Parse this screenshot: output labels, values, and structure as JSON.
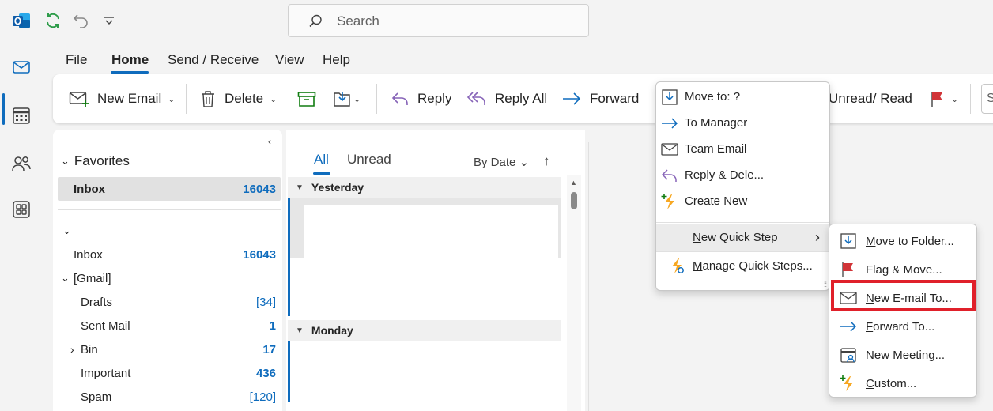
{
  "search": {
    "placeholder": "Search"
  },
  "menu": {
    "items": [
      "File",
      "Home",
      "Send / Receive",
      "View",
      "Help"
    ],
    "active": "Home"
  },
  "ribbon": {
    "new_email": "New Email",
    "delete": "Delete",
    "reply": "Reply",
    "reply_all": "Reply All",
    "forward": "Forward",
    "unread_read": "Unread/ Read",
    "chev": "⌄"
  },
  "favorites": {
    "title": "Favorites",
    "items": [
      {
        "name": "Inbox",
        "count": "16043"
      }
    ]
  },
  "account": {
    "folders": [
      {
        "name": "Inbox",
        "count": "16043"
      },
      {
        "name": "[Gmail]",
        "count": ""
      },
      {
        "name": "Drafts",
        "count": "[34]"
      },
      {
        "name": "Sent Mail",
        "count": "1"
      },
      {
        "name": "Bin",
        "count": "17"
      },
      {
        "name": "Important",
        "count": "436"
      },
      {
        "name": "Spam",
        "count": "[120]"
      }
    ]
  },
  "message_list": {
    "tabs": [
      "All",
      "Unread"
    ],
    "sort": "By Date",
    "sort_dir": "↑",
    "groups": [
      "Yesterday",
      "Monday"
    ]
  },
  "quick_steps": {
    "items": [
      "Move to: ?",
      "To Manager",
      "Team Email",
      "Reply & Dele...",
      "Create New"
    ],
    "new_quick_step": "New Quick Step",
    "manage": "Manage Quick Steps...",
    "submenu_arrow": "›"
  },
  "new_quick_step_menu": {
    "items": [
      "Move to Folder...",
      "Flag & Move...",
      "New E-mail To...",
      "Forward To...",
      "New Meeting...",
      "Custom..."
    ],
    "highlighted": "New E-mail To..."
  },
  "colors": {
    "accent": "#0f6cbd",
    "highlight_box": "#e0202a",
    "flag": "#d13438"
  }
}
